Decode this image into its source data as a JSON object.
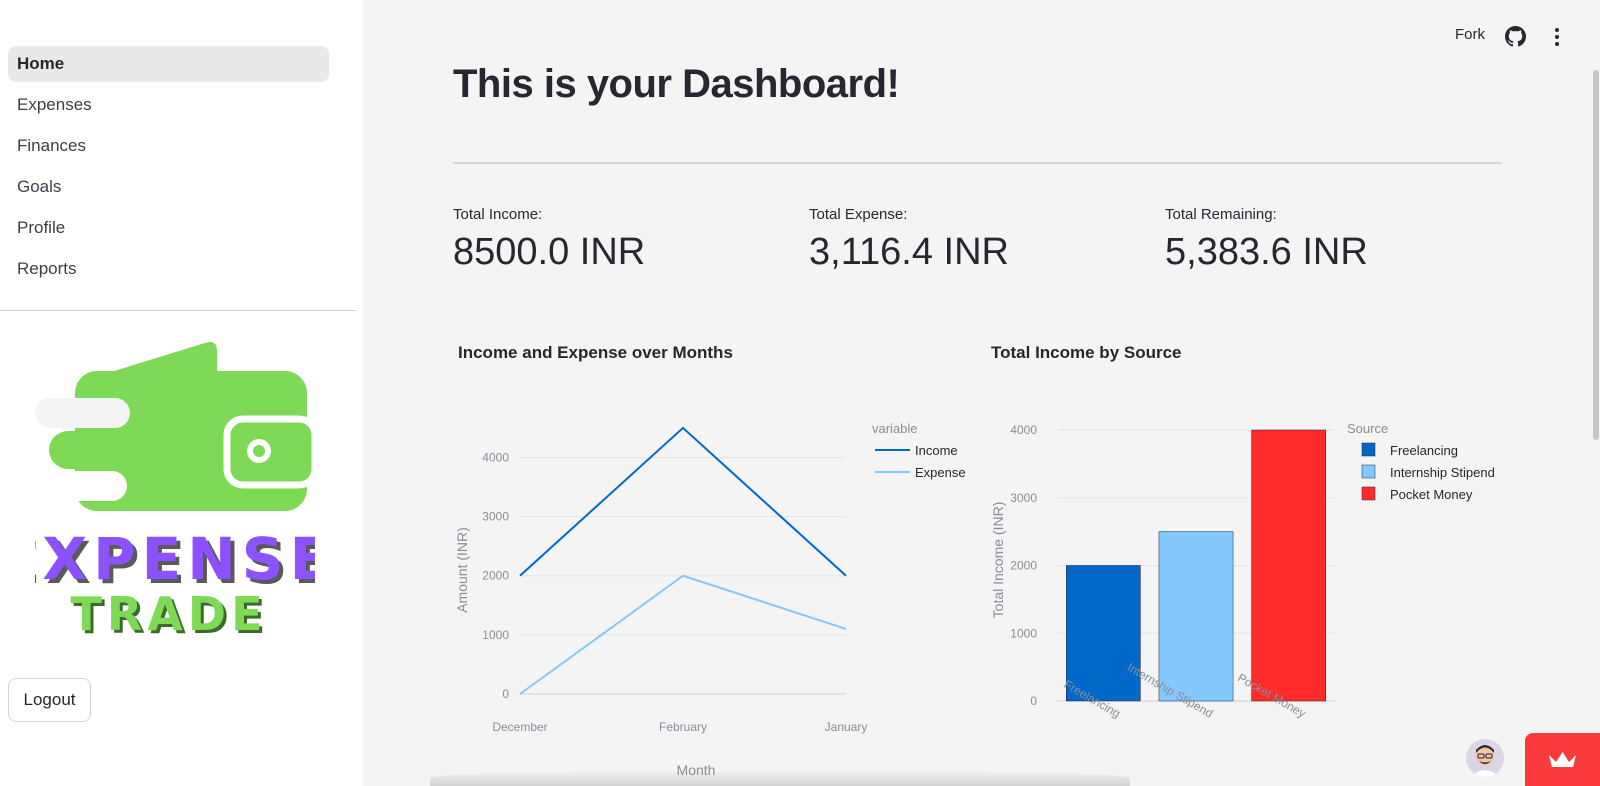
{
  "sidebar": {
    "items": [
      {
        "label": "Home",
        "active": true
      },
      {
        "label": "Expenses"
      },
      {
        "label": "Finances"
      },
      {
        "label": "Goals"
      },
      {
        "label": "Profile"
      },
      {
        "label": "Reports"
      }
    ],
    "logo": {
      "line1": "EXPENSE",
      "line2": "TRADE",
      "icon": "wallet-icon"
    },
    "logout_label": "Logout"
  },
  "header": {
    "fork_label": "Fork",
    "icons": [
      "github-icon",
      "more-vertical-icon"
    ]
  },
  "main": {
    "title": "This is your Dashboard!",
    "metrics": [
      {
        "label": "Total Income:",
        "value": "8500.0 INR"
      },
      {
        "label": "Total Expense:",
        "value": "3,116.4 INR"
      },
      {
        "label": "Total Remaining:",
        "value": "5,383.6 INR"
      }
    ]
  },
  "colors": {
    "income": "#0068c9",
    "expense": "#83c9ff",
    "pocket": "#ff2b2b",
    "logo_green": "#7ed957",
    "logo_purple": "#8c52ff"
  },
  "chart_data": [
    {
      "type": "line",
      "title": "Income and Expense over Months",
      "xlabel": "Month",
      "ylabel": "Amount (INR)",
      "categories": [
        "December",
        "February",
        "January"
      ],
      "ylim": [
        0,
        4600
      ],
      "yticks": [
        0,
        1000,
        2000,
        3000,
        4000
      ],
      "legend_title": "variable",
      "legend_position": "top-right",
      "grid": true,
      "series": [
        {
          "name": "Income",
          "values": [
            2000,
            4500,
            2000
          ]
        },
        {
          "name": "Expense",
          "values": [
            0,
            2000,
            1100
          ]
        }
      ]
    },
    {
      "type": "bar",
      "title": "Total Income by Source",
      "xlabel": "",
      "ylabel": "Total Income (INR)",
      "categories": [
        "Freelancing",
        "Internship Stipend",
        "Pocket Money"
      ],
      "values": [
        2000,
        2500,
        4000
      ],
      "ylim": [
        0,
        4000
      ],
      "yticks": [
        0,
        1000,
        2000,
        3000,
        4000
      ],
      "legend_title": "Source",
      "legend_position": "top-right",
      "grid": true
    }
  ]
}
